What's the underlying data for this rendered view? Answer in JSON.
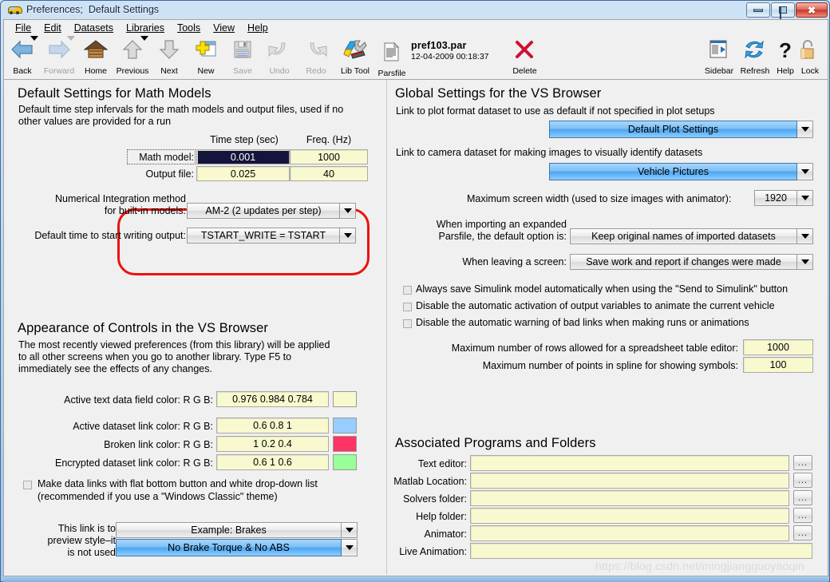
{
  "window": {
    "title": "Preferences;  Default Settings",
    "icon": "car-icon",
    "minimize_label": "minimize",
    "maximize_label": "maximize",
    "close_label": "✖"
  },
  "menu": {
    "items": [
      "File",
      "Edit",
      "Datasets",
      "Libraries",
      "Tools",
      "View",
      "Help"
    ]
  },
  "toolbar": {
    "buttons": [
      {
        "label": "Back",
        "icon": "back-arrow-icon",
        "disabled": false,
        "dropdown": true
      },
      {
        "label": "Forward",
        "icon": "forward-arrow-icon",
        "disabled": true,
        "dropdown": true
      },
      {
        "label": "Home",
        "icon": "home-icon",
        "disabled": false,
        "dropdown": false
      },
      {
        "label": "Previous",
        "icon": "up-arrow-icon",
        "disabled": false,
        "dropdown": true
      },
      {
        "label": "Next",
        "icon": "down-arrow-icon",
        "disabled": false,
        "dropdown": false
      },
      {
        "label": "New",
        "icon": "new-file-icon",
        "disabled": false,
        "dropdown": false
      },
      {
        "label": "Save",
        "icon": "floppy-disk-icon",
        "disabled": true,
        "dropdown": false
      },
      {
        "label": "Undo",
        "icon": "undo-arrow-icon",
        "disabled": true,
        "dropdown": false
      },
      {
        "label": "Redo",
        "icon": "redo-arrow-icon",
        "disabled": true,
        "dropdown": false
      },
      {
        "label": "Lib Tool",
        "icon": "wrench-icon",
        "disabled": false,
        "dropdown": false
      },
      {
        "label": "Parsfile",
        "icon": "document-icon",
        "disabled": false,
        "dropdown": false
      }
    ],
    "parsfile": {
      "name": "pref103.par",
      "date": "12-04-2009 00:18:37"
    },
    "delete": {
      "label": "Delete",
      "icon": "red-x-icon"
    },
    "right_buttons": [
      {
        "label": "Sidebar",
        "icon": "sidebar-icon"
      },
      {
        "label": "Refresh",
        "icon": "refresh-icon"
      },
      {
        "label": "Help",
        "icon": "question-mark-icon"
      },
      {
        "label": "Lock",
        "icon": "padlock-icon"
      }
    ]
  },
  "left": {
    "math_models": {
      "heading": "Default Settings for Math Models",
      "description_line1": "Default time step infervals for the math models and output files, used if no",
      "description_line2": "other values are provided for a run",
      "col_headers": [
        "Time step (sec)",
        "Freq. (Hz)"
      ],
      "rows": [
        {
          "label": "Math model:",
          "time_step": "0.001",
          "freq": "1000",
          "selected": true
        },
        {
          "label": "Output file:",
          "time_step": "0.025",
          "freq": "40",
          "selected": false
        }
      ]
    },
    "integration": {
      "label_line1": "Numerical Integration method",
      "label_line2": "for built-in models:",
      "value": "AM-2 (2 updates per step)"
    },
    "tstart": {
      "label": "Default time to start writing output:",
      "value": "TSTART_WRITE = TSTART"
    },
    "appearance": {
      "heading": "Appearance of Controls in the VS Browser",
      "description_line1": "The most recently viewed preferences (from this library) will be applied",
      "description_line2": "to all other screens when you go to another library. Type F5 to",
      "description_line3": "immediately see the effects of any changes.",
      "colors": [
        {
          "label": "Active text data field color: R G B:",
          "value": "0.976 0.984 0.784",
          "swatch": "#f9f9cf"
        },
        {
          "label": "Active dataset link color: R G B:",
          "value": "0.6 0.8 1",
          "swatch": "#99ccff"
        },
        {
          "label": "Broken link color: R G B:",
          "value": "1 0.2 0.4",
          "swatch": "#ff3366"
        },
        {
          "label": "Encrypted dataset link color: R G B:",
          "value": "0.6 1 0.6",
          "swatch": "#99ff99"
        }
      ],
      "flat_checkbox": {
        "checked": false,
        "line1": "Make data links with flat bottom button and white drop-down list",
        "line2": "(recommended if you use a \"Windows Classic\" theme)"
      },
      "preview": {
        "label_line1": "This link is to",
        "label_line2": "preview style–it",
        "label_line3": "is not  used",
        "top_value": "Example: Brakes",
        "bottom_value": "No Brake Torque & No ABS"
      }
    }
  },
  "right": {
    "global": {
      "heading": "Global Settings for the VS Browser",
      "plot_desc": "Link to plot format dataset to use as default if not specified in plot setups",
      "plot_value": "Default Plot Settings",
      "camera_desc": "Link to camera dataset for making images to visually identify datasets",
      "camera_value": "Vehicle Pictures",
      "screen_width_label": "Maximum screen width (used to size images with animator):",
      "screen_width_value": "1920",
      "parsfile_label_line1": "When importing an expanded",
      "parsfile_label_line2": "Parsfile, the default option is:",
      "parsfile_value": "Keep original names of imported datasets",
      "leaving_label": "When leaving a screen:",
      "leaving_value": "Save work and report if changes were made",
      "checkboxes": [
        {
          "checked": false,
          "label": "Always save Simulink model automatically when using the \"Send to Simulink\" button"
        },
        {
          "checked": false,
          "label": "Disable the automatic activation of output variables to animate the current vehicle"
        },
        {
          "checked": false,
          "label": "Disable the automatic warning of bad links when making runs or animations"
        }
      ],
      "max_rows_label": "Maximum number of rows allowed for a spreadsheet table editor:",
      "max_rows_value": "1000",
      "max_points_label": "Maximum number of points in spline for showing symbols:",
      "max_points_value": "100"
    },
    "associated": {
      "heading": "Associated Programs and Folders",
      "rows": [
        {
          "label": "Text editor:",
          "value": "",
          "browse": true
        },
        {
          "label": "Matlab Location:",
          "value": "",
          "browse": true
        },
        {
          "label": "Solvers folder:",
          "value": "",
          "browse": true
        },
        {
          "label": "Help folder:",
          "value": "",
          "browse": true
        },
        {
          "label": "Animator:",
          "value": "",
          "browse": true
        },
        {
          "label": "Live Animation:",
          "value": "",
          "browse": false
        }
      ],
      "browse_label": "..."
    }
  },
  "watermark": "https://blog.csdn.net/mingjiangguoyaoqin",
  "accents": {
    "annotation_red": "#ee1111",
    "selection_navy": "#14143c",
    "field_yellow": "#f9f9cf",
    "link_blue": "#7cc0f7"
  }
}
